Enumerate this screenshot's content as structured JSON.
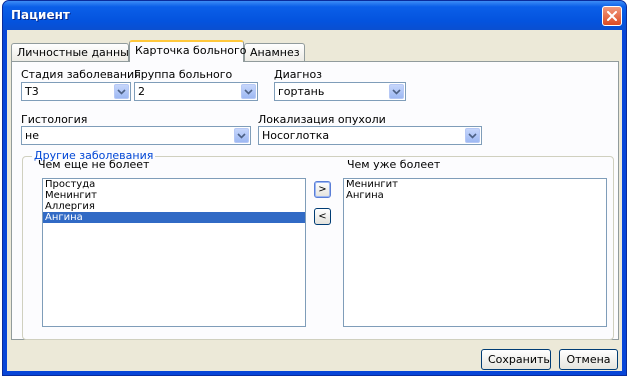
{
  "window": {
    "title": "Пациент"
  },
  "tabs": [
    {
      "label": "Личностные данные"
    },
    {
      "label": "Карточка больного"
    },
    {
      "label": "Анамнез"
    }
  ],
  "form": {
    "stage": {
      "label": "Стадия заболевания",
      "value": "T3"
    },
    "group": {
      "label": "Группа больного",
      "value": "2"
    },
    "diagnosis": {
      "label": "Диагноз",
      "value": "гортань"
    },
    "histology": {
      "label": "Гистология",
      "value": "не"
    },
    "localization": {
      "label": "Локализация опухоли",
      "value": "Носоглотка"
    }
  },
  "diseases": {
    "legend": "Другие заболевания",
    "available_label": "Чем еще не болеет",
    "current_label": "Чем уже болеет",
    "available": [
      "Простуда",
      "Менингит",
      "Аллергия",
      "Ангина"
    ],
    "current": [
      "Менингит",
      "Ангина"
    ],
    "add_label": ">",
    "remove_label": "<"
  },
  "buttons": {
    "save": "Сохранить",
    "cancel": "Отмена"
  },
  "icons": {
    "close": "close-icon",
    "dropdown": "chevron-down-icon"
  },
  "colors": {
    "titlebar": "#0453de",
    "accent": "#0046d5",
    "selection": "#316ac5",
    "close": "#dc4a22"
  }
}
